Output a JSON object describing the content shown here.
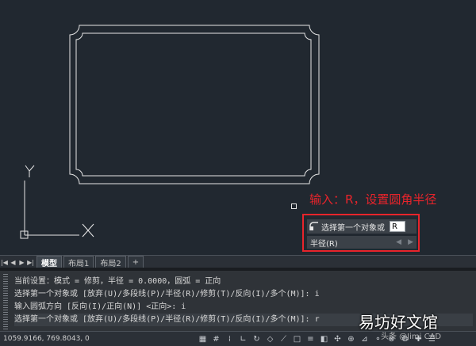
{
  "annotation": {
    "text": "输入：R，设置圆角半径"
  },
  "ucs": {
    "y_label": "Y",
    "x_label": "X"
  },
  "dynamic_input": {
    "prompt": "选择第一个对象或",
    "value": "R",
    "option": "半径(R)",
    "icon": "fillet-icon"
  },
  "layout_tabs": {
    "nav": [
      "|◀",
      "◀",
      "▶",
      "▶|"
    ],
    "tabs": [
      {
        "label": "模型",
        "active": true
      },
      {
        "label": "布局1",
        "active": false
      },
      {
        "label": "布局2",
        "active": false
      },
      {
        "label": "+",
        "active": false
      }
    ]
  },
  "command_history": [
    "当前设置：模式 = 修剪，半径 = 0.0000，圆弧 = 正向",
    "选择第一个对象或 [放弃(U)/多段线(P)/半径(R)/修剪(T)/反向(I)/多个(M)]: i",
    "输入圆弧方向 [反向(I)/正向(N)] <正向>: i",
    "选择第一个对象或 [放弃(U)/多段线(P)/半径(R)/修剪(T)/反向(I)/多个(M)]: r"
  ],
  "status_bar": {
    "coordinates": "1059.9166, 769.8043, 0",
    "icons": [
      "model-space-icon",
      "grid-icon",
      "snap-icon",
      "ortho-icon",
      "polar-icon",
      "isometric-icon",
      "osnap-track-icon",
      "osnap-icon",
      "lineweight-icon",
      "transparency-icon",
      "selection-cycling-icon",
      "3d-osnap-icon",
      "dynamic-ucs-icon",
      "selection-filter-icon",
      "gizmo-icon",
      "annotation-icon",
      "workspace-icon",
      "customize-icon"
    ]
  },
  "watermark": {
    "text": "易坊好文馆",
    "sub": "头条 @Jimi CAD"
  },
  "colors": {
    "background": "#212830",
    "annotation": "#e8242b",
    "lines": "#e6e6e6"
  }
}
